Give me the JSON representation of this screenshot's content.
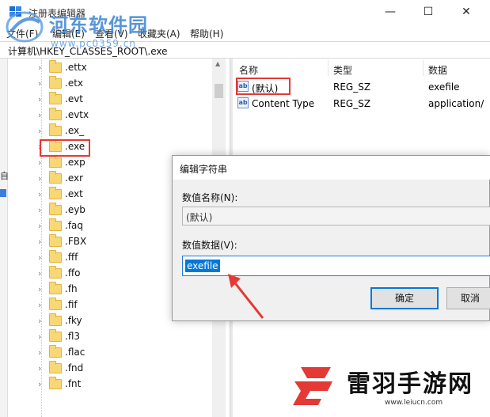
{
  "window": {
    "title": "注册表编辑器",
    "minimize": "—",
    "maximize": "☐",
    "close": "✕"
  },
  "menu": [
    {
      "label": "文件(F)"
    },
    {
      "label": "编辑(E)"
    },
    {
      "label": "查看(V)"
    },
    {
      "label": "收藏夹(A)"
    },
    {
      "label": "帮助(H)"
    }
  ],
  "address": "计算机\\HKEY_CLASSES_ROOT\\.exe",
  "left_strip": {
    "text": "自"
  },
  "tree": {
    "items": [
      {
        "label": ".ettx"
      },
      {
        "label": ".etx"
      },
      {
        "label": ".evt"
      },
      {
        "label": ".evtx"
      },
      {
        "label": ".ex_"
      },
      {
        "label": ".exe",
        "selected": true
      },
      {
        "label": ".exp"
      },
      {
        "label": ".exr"
      },
      {
        "label": ".ext"
      },
      {
        "label": ".eyb"
      },
      {
        "label": ".faq"
      },
      {
        "label": ".FBX"
      },
      {
        "label": ".fff"
      },
      {
        "label": ".ffo"
      },
      {
        "label": ".fh"
      },
      {
        "label": ".fif"
      },
      {
        "label": ".fky"
      },
      {
        "label": ".fl3"
      },
      {
        "label": ".flac"
      },
      {
        "label": ".fnd"
      },
      {
        "label": ".fnt"
      }
    ]
  },
  "values_pane": {
    "columns": [
      "名称",
      "类型",
      "数据"
    ],
    "rows": [
      {
        "name": "(默认)",
        "type": "REG_SZ",
        "data": "exefile",
        "icon": "ab"
      },
      {
        "name": "Content Type",
        "type": "REG_SZ",
        "data": "application/",
        "icon": "ab"
      }
    ]
  },
  "dialog": {
    "title": "编辑字符串",
    "name_label": "数值名称(N):",
    "name_value": "(默认)",
    "data_label": "数值数据(V):",
    "data_value": "exefile",
    "ok": "确定",
    "cancel": "取消"
  },
  "watermark_top": {
    "brand": "河东软件园",
    "site": "www.pc0359.cn"
  },
  "watermark_bottom": {
    "brand": "雷羽手游网",
    "site": "www.leiucn.com"
  },
  "colors": {
    "highlight": "#e53935",
    "selection": "#0078d7",
    "folder": "#f8d775"
  }
}
